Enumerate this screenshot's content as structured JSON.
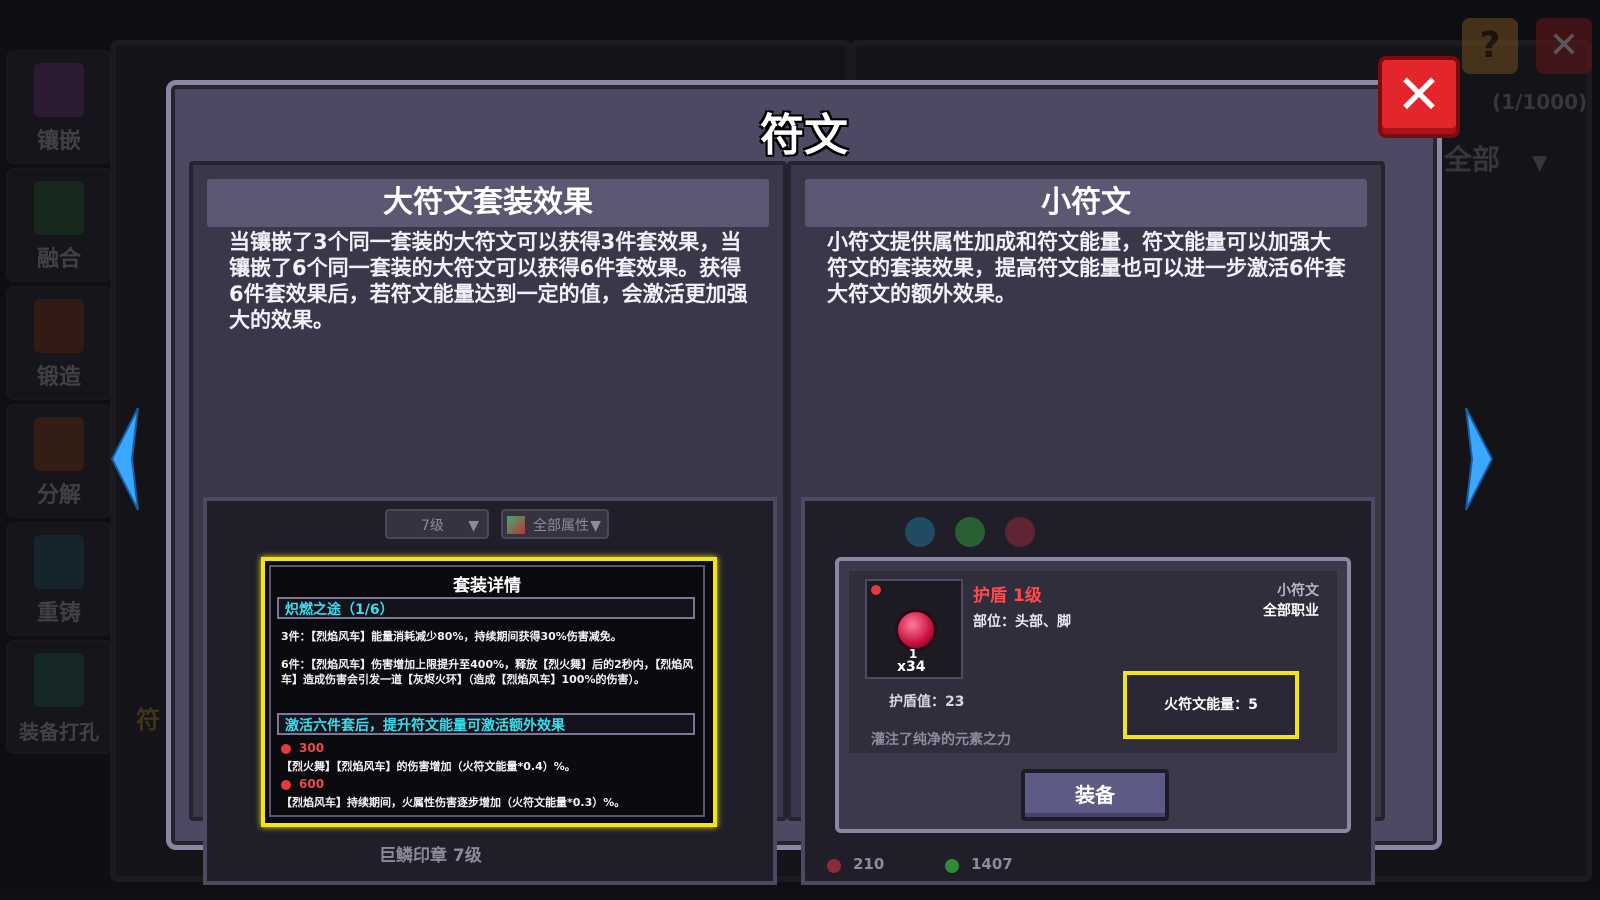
{
  "background": {
    "sidebar": [
      {
        "label": "镶嵌",
        "icon": "socket-icon"
      },
      {
        "label": "融合",
        "icon": "fusion-icon"
      },
      {
        "label": "锻造",
        "icon": "forge-icon"
      },
      {
        "label": "分解",
        "icon": "decompose-icon"
      },
      {
        "label": "重铸",
        "icon": "recast-icon"
      },
      {
        "label": "装备打孔",
        "icon": "punch-icon"
      }
    ],
    "help_label": "?",
    "close_label": "✕",
    "counter": "(1/1000)",
    "filter_label": "全部",
    "left_edge_label": "符"
  },
  "dialog": {
    "title": "符文",
    "close_label": "✕",
    "left_panel": {
      "heading": "大符文套装效果",
      "description": "当镶嵌了3个同一套装的大符文可以获得3件套效果，当镶嵌了6个同一套装的大符文可以获得6件套效果。获得6件套效果后，若符文能量达到一定的值，会激活更加强大的效果。",
      "screenshot": {
        "level_dropdown": "7级",
        "attr_dropdown": "全部属性",
        "tooltip": {
          "title": "套装详情",
          "set_name": "炽燃之途（1/6）",
          "three_piece": "3件：【烈焰风车】能量消耗减少80%，持续期间获得30%伤害减免。",
          "six_piece": "6件：【烈焰风车】伤害增加上限提升至400%，释放【烈火舞】后的2秒内，【烈焰风车】造成伤害会引发一道【灰烬火环】（造成【烈焰风车】100%的伤害）。",
          "extra_header": "激活六件套后，提升符文能量可激活额外效果",
          "tier1_value": "300",
          "tier1_text": "【烈火舞】【烈焰风车】的伤害增加（火符文能量*0.4）%。",
          "tier2_value": "600",
          "tier2_text": "【烈焰风车】持续期间，火属性伤害逐步增加（火符文能量*0.3）%。"
        },
        "footer_item": "巨鳞印章 7级"
      }
    },
    "right_panel": {
      "heading": "小符文",
      "description": "小符文提供属性加成和符文能量，符文能量可以加强大符文的套装效果，提高符文能量也可以进一步激活6件套大符文的额外效果。",
      "screenshot": {
        "item": {
          "name": "护盾 1级",
          "slot_text": "部位：头部、脚",
          "type": "小符文",
          "class": "全部职业",
          "count": "x34",
          "level": "1",
          "stat": "护盾值：23",
          "energy": "火符文能量：5",
          "flavor": "灌注了纯净的元素之力",
          "equip_label": "装备"
        },
        "footer_values": [
          "210",
          "1407"
        ]
      }
    }
  },
  "colors": {
    "dialog_bg": "#4d4962",
    "highlight": "#f2e31a",
    "close_red": "#e2262b",
    "cyan_text": "#36e0f0",
    "item_name_red": "#ff4b4b"
  }
}
